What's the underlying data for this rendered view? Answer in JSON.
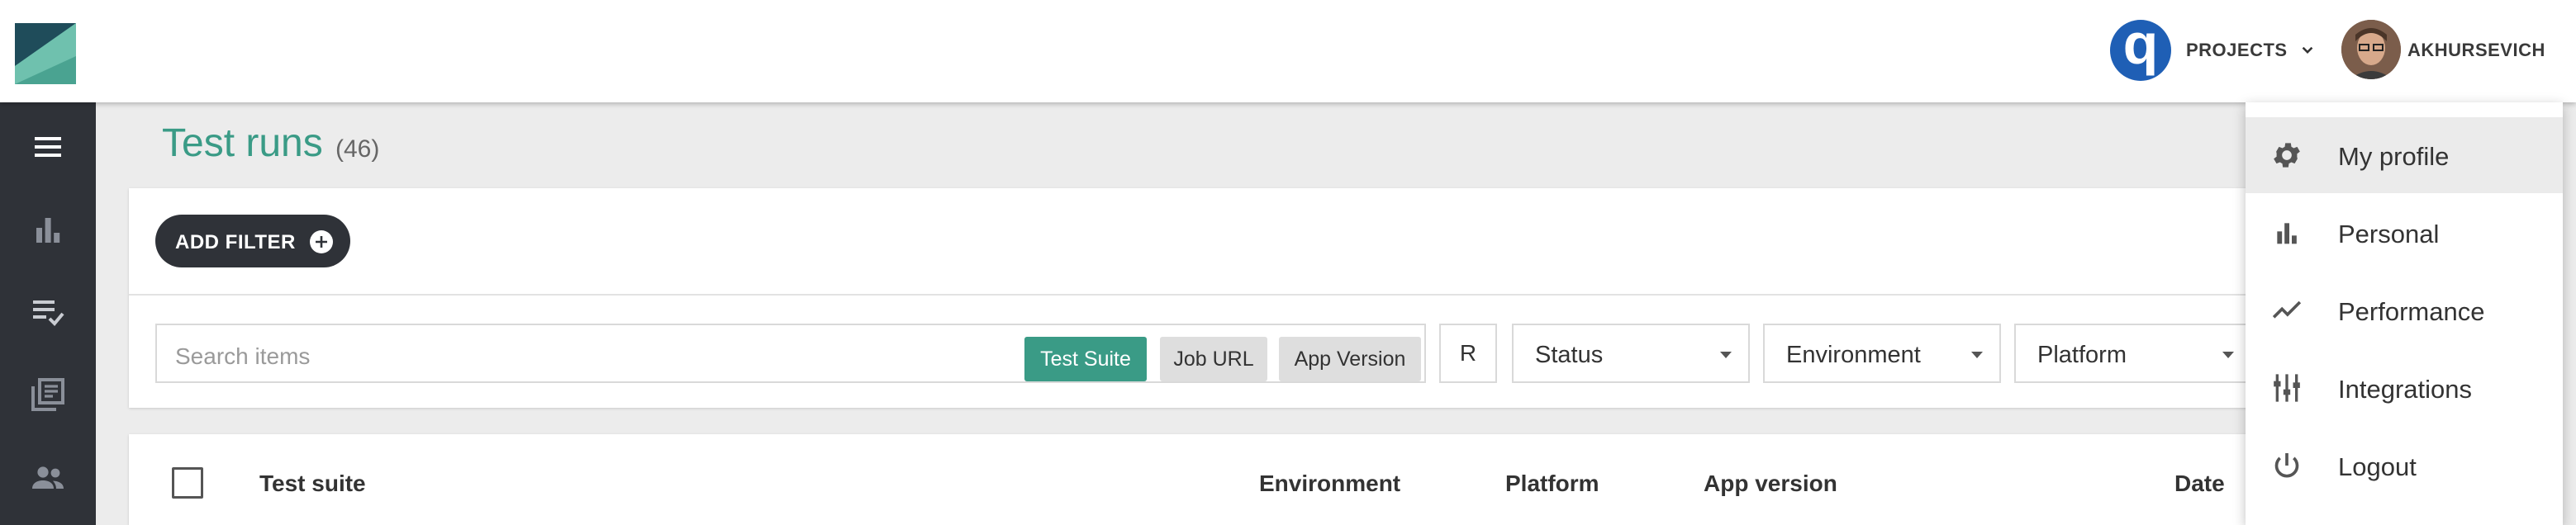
{
  "header": {
    "projects_label": "PROJECTS",
    "username": "AKHURSEVICH"
  },
  "page": {
    "title": "Test runs",
    "count": "(46)"
  },
  "filter": {
    "add_filter_label": "ADD FILTER",
    "search_placeholder": "Search items",
    "chips": [
      "Test Suite",
      "Job URL",
      "App Version"
    ],
    "r_button": "R",
    "selects": [
      "Status",
      "Environment",
      "Platform"
    ]
  },
  "table": {
    "columns": [
      "Test suite",
      "Environment",
      "Platform",
      "App version",
      "Date"
    ]
  },
  "sidebar": {
    "icons": [
      "menu-icon",
      "bar-chart-icon",
      "playlist-check-icon",
      "library-books-icon",
      "people-icon"
    ]
  },
  "user_menu": {
    "items": [
      {
        "label": "My profile",
        "icon": "gear-icon",
        "highlighted": true
      },
      {
        "label": "Personal",
        "icon": "bar-chart-icon",
        "highlighted": false
      },
      {
        "label": "Performance",
        "icon": "trending-line-icon",
        "highlighted": false
      },
      {
        "label": "Integrations",
        "icon": "integrations-icon",
        "highlighted": false
      },
      {
        "label": "Logout",
        "icon": "power-icon",
        "highlighted": false
      }
    ]
  },
  "colors": {
    "accent": "#3a9b86",
    "sidebar": "#2f3238",
    "project_logo": "#1f5fb5"
  }
}
